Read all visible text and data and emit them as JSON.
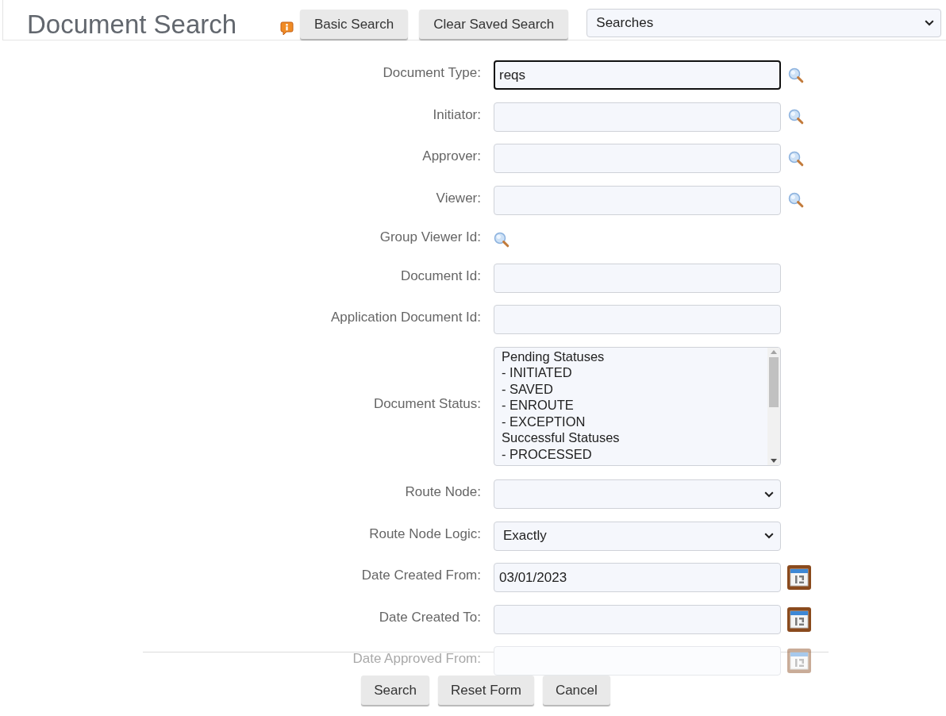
{
  "header": {
    "title": "Document Search",
    "buttons": [
      "Basic Search",
      "Clear Saved Search"
    ],
    "saved_searches": {
      "value": "Searches"
    }
  },
  "form": {
    "fields": [
      {
        "kind": "text",
        "label": "Document Type:",
        "value": "reqs",
        "focused": true,
        "lookup": true
      },
      {
        "kind": "text",
        "label": "Initiator:",
        "focused": false,
        "lookup": true
      },
      {
        "kind": "text",
        "label": "Approver:",
        "focused": false,
        "lookup": true
      },
      {
        "kind": "text",
        "label": "Viewer:",
        "focused": false,
        "lookup": true
      },
      {
        "kind": "lookup",
        "label": "Group Viewer Id:"
      },
      {
        "kind": "text",
        "label": "Document Id:",
        "focused": false,
        "lookup": false
      },
      {
        "kind": "text",
        "label": "Application Document Id:",
        "focused": false,
        "lookup": false
      },
      {
        "kind": "listbox",
        "label": "Document Status:",
        "options": [
          {
            "text": "Pending Statuses",
            "selected": false
          },
          {
            "text": "- INITIATED",
            "selected": false
          },
          {
            "text": "- SAVED",
            "selected": false
          },
          {
            "text": "- ENROUTE",
            "selected": false
          },
          {
            "text": "- EXCEPTION",
            "selected": false
          },
          {
            "text": "Successful Statuses",
            "selected": false
          },
          {
            "text": "- PROCESSED",
            "selected": false
          }
        ]
      },
      {
        "kind": "select",
        "label": "Route Node:"
      },
      {
        "kind": "select",
        "label": "Route Node Logic:",
        "value": "Exactly"
      },
      {
        "kind": "date",
        "label": "Date Created From:",
        "value": "03/01/2023",
        "focused": false
      },
      {
        "kind": "date",
        "label": "Date Created To:",
        "focused": false
      }
    ]
  },
  "footer": {
    "covered_fields": [
      {
        "kind": "date",
        "label": "Date Approved From:",
        "focused": false
      }
    ],
    "actions": [
      "Search",
      "Reset Form",
      "Cancel"
    ]
  }
}
